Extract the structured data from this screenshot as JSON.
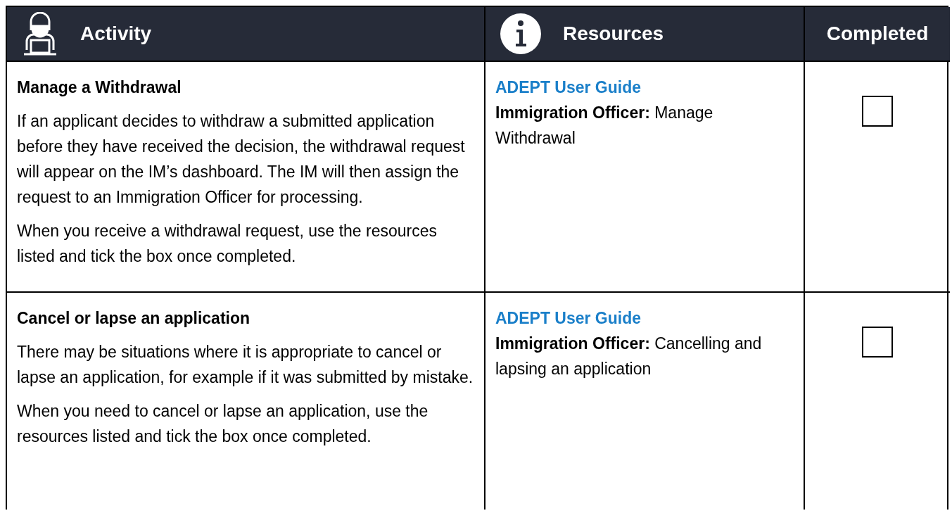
{
  "table": {
    "columns": [
      {
        "label": "Activity",
        "kind": "person"
      },
      {
        "label": "Resources",
        "kind": "info"
      },
      {
        "label": "Completed",
        "kind": "plain"
      }
    ],
    "rows": [
      {
        "title": "Manage a Withdrawal",
        "paragraphs": [
          "If an applicant decides to withdraw a submitted application before they have received the decision, the withdrawal request will appear on the IM’s dashboard. The IM will then assign the request to an Immigration Officer for processing.",
          "When you receive a withdrawal request, use the resources listed and tick the box once completed."
        ],
        "resource_link": "ADEPT User Guide",
        "resource_text": "**Immigration Officer:** Manage Withdrawal",
        "completed": false
      },
      {
        "title": "Cancel or lapse an application",
        "paragraphs": [
          "There may be situations where it is appropriate to cancel or lapse an application, for example if it was submitted by mistake.",
          "When you need to cancel or lapse an application, use the resources listed and tick the box once completed."
        ],
        "resource_link": "ADEPT User Guide",
        "resource_text": "**Immigration Officer:** Cancelling and lapsing an application",
        "completed": false
      }
    ]
  }
}
